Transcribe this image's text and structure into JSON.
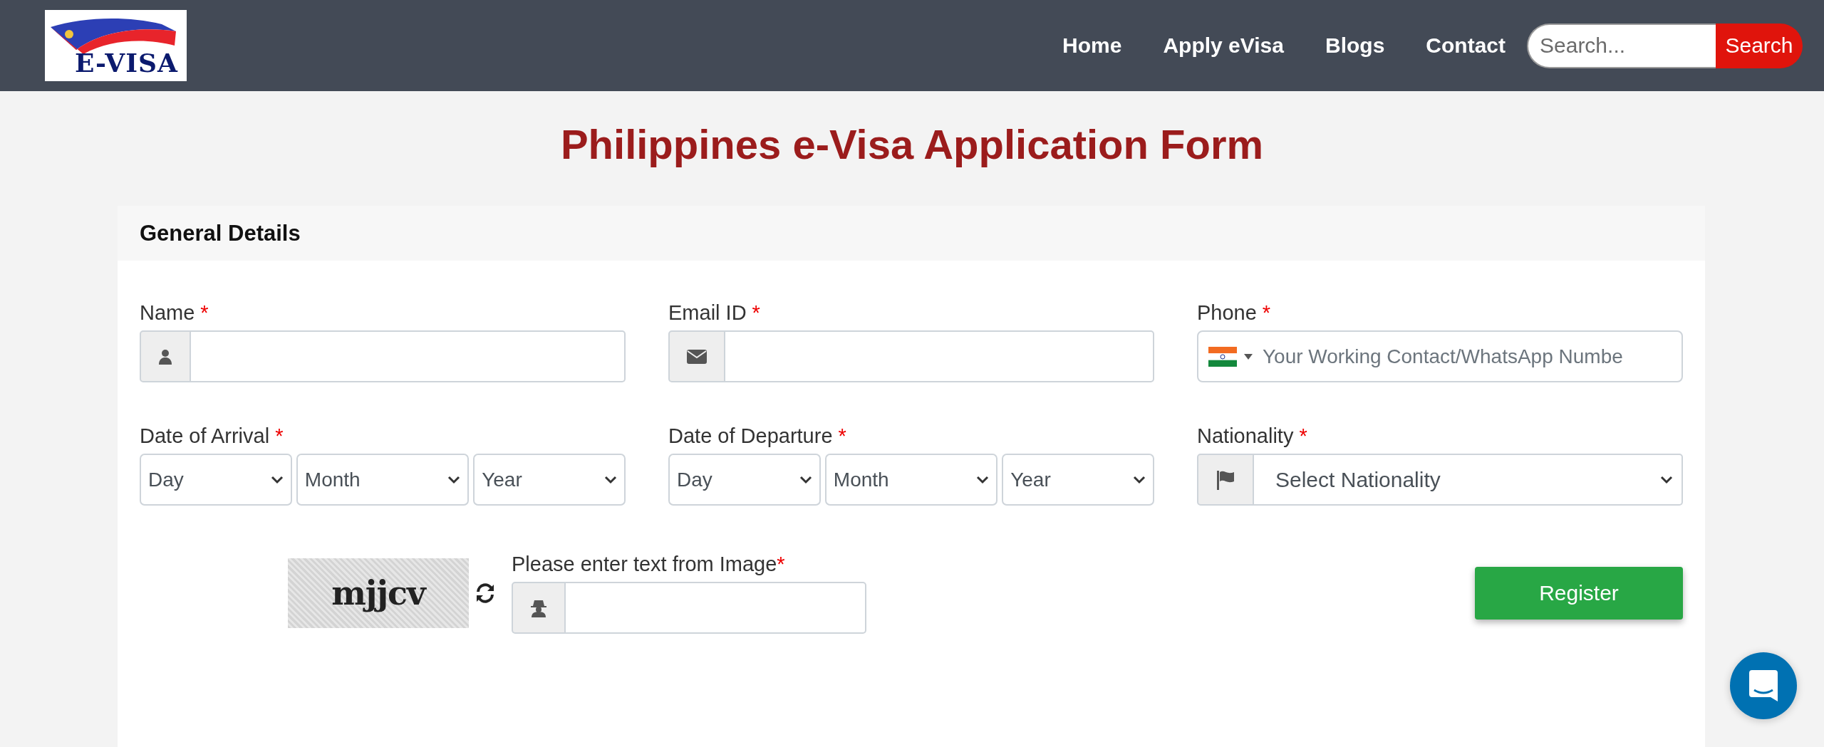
{
  "header": {
    "logo_text": "E-VISA",
    "nav": [
      {
        "label": "Home"
      },
      {
        "label": "Apply eVisa"
      },
      {
        "label": "Blogs"
      },
      {
        "label": "Contact"
      }
    ],
    "search": {
      "placeholder": "Search...",
      "button": "Search"
    }
  },
  "title": "Philippines e-Visa Application Form",
  "section": {
    "title": "General Details"
  },
  "fields": [
    {
      "kind": "icon-input",
      "label": "Name",
      "mark": "*"
    },
    {
      "kind": "icon-input",
      "label": "Email ID",
      "mark": "*"
    },
    {
      "kind": "phone",
      "label": "Phone",
      "mark": "*",
      "placeholder": "Your Working Contact/WhatsApp Numbe"
    },
    {
      "kind": "date",
      "label": "Date of Arrival",
      "mark": "*",
      "selects": [
        "Day",
        "Month",
        "Year"
      ]
    },
    {
      "kind": "date",
      "label": "Date of Departure",
      "mark": "*",
      "selects": [
        "Day",
        "Month",
        "Year"
      ]
    },
    {
      "kind": "icon-select",
      "label": "Nationality",
      "mark": "*",
      "value": "Select Nationality"
    }
  ],
  "captcha": {
    "image_text": "mjjcv",
    "label": "Please enter text from Image",
    "mark": "*"
  },
  "register": "Register"
}
